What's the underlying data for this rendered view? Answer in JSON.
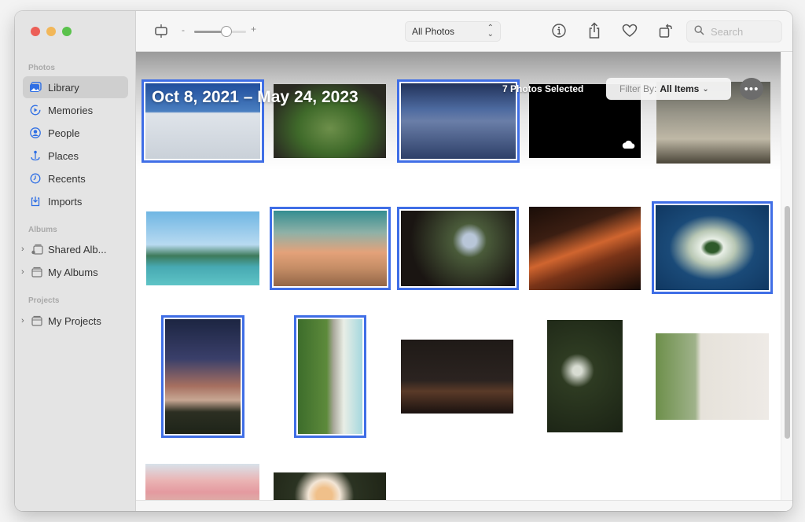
{
  "window": {
    "traffic_lights": {
      "close": "#ec5f57",
      "minimize": "#f2b759",
      "maximize": "#5ac24c"
    }
  },
  "sidebar": {
    "sections": [
      {
        "label": "Photos",
        "items": [
          {
            "label": "Library",
            "icon": "library-icon",
            "active": true
          },
          {
            "label": "Memories",
            "icon": "memories-icon"
          },
          {
            "label": "People",
            "icon": "people-icon"
          },
          {
            "label": "Places",
            "icon": "places-icon"
          },
          {
            "label": "Recents",
            "icon": "recents-icon"
          },
          {
            "label": "Imports",
            "icon": "imports-icon"
          }
        ]
      },
      {
        "label": "Albums",
        "items": [
          {
            "label": "Shared Alb...",
            "icon": "shared-album-icon",
            "expandable": true
          },
          {
            "label": "My Albums",
            "icon": "folder-icon",
            "expandable": true
          }
        ]
      },
      {
        "label": "Projects",
        "items": [
          {
            "label": "My Projects",
            "icon": "folder-icon",
            "expandable": true
          }
        ]
      }
    ]
  },
  "toolbar": {
    "zoom_minus": "-",
    "zoom_plus": "+",
    "zoom_level_fraction": 0.62,
    "view_select": "All Photos",
    "search_placeholder": "Search",
    "accent": "#3f6ee6"
  },
  "library": {
    "date_range": "Oct 8, 2021 – May 24, 2023",
    "selection_text": "7 Photos Selected",
    "filter_label": "Filter By:",
    "filter_value": "All Items",
    "more_label": "•••",
    "selected_count": 7
  },
  "photos": [
    {
      "subject": "person jumping on salt flat",
      "selected": true
    },
    {
      "subject": "waterfall in cave",
      "selected": false
    },
    {
      "subject": "snowy mountain valley",
      "selected": true
    },
    {
      "subject": "black image (iCloud)",
      "selected": false,
      "cloud": true
    },
    {
      "subject": "screen text photo",
      "selected": false
    },
    {
      "subject": "limestone karsts bay",
      "selected": false
    },
    {
      "subject": "beach sunset cliff",
      "selected": true
    },
    {
      "subject": "phone photo at night",
      "selected": true
    },
    {
      "subject": "slot canyon",
      "selected": false
    },
    {
      "subject": "aerial atoll island",
      "selected": true
    },
    {
      "subject": "rock pinnacles at dusk",
      "selected": true
    },
    {
      "subject": "aerial forest beach",
      "selected": true
    },
    {
      "subject": "mountains under stars",
      "selected": false
    },
    {
      "subject": "dandelions",
      "selected": false
    },
    {
      "subject": "cat at window",
      "selected": false
    },
    {
      "subject": "pink flowers",
      "selected": false
    },
    {
      "subject": "white rose",
      "selected": false
    }
  ]
}
